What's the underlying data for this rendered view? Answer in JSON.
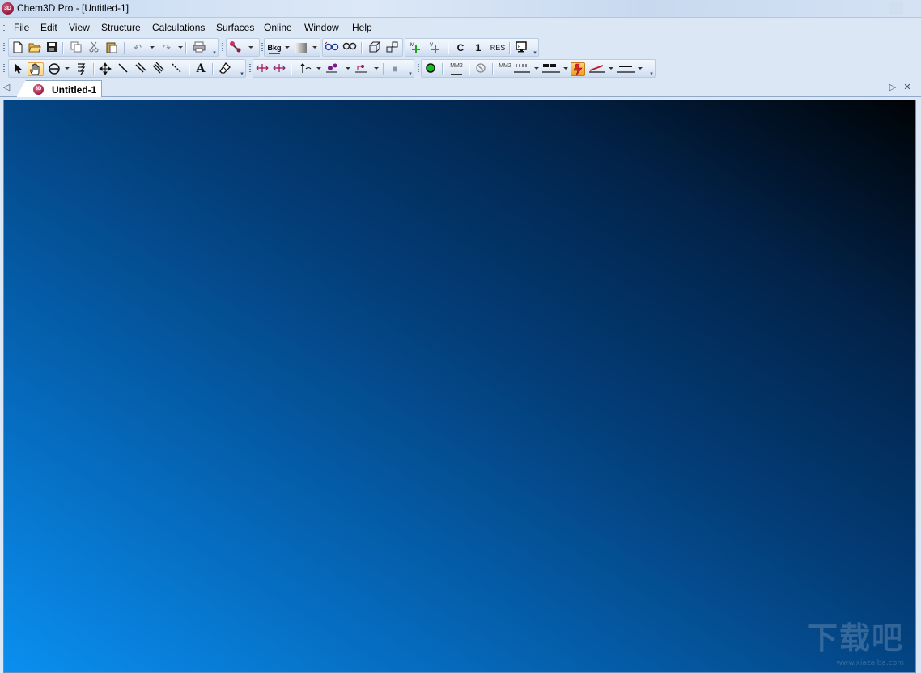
{
  "window": {
    "title": "Chem3D Pro - [Untitled-1]",
    "app_icon": "chem3d-app-icon",
    "app_icon_text": "3D"
  },
  "menu": {
    "items": [
      "File",
      "Edit",
      "View",
      "Structure",
      "Calculations",
      "Surfaces",
      "Online",
      "Window",
      "Help"
    ]
  },
  "toolbar1": {
    "new": "new-document-icon",
    "open": "open-folder-icon",
    "save": "save-icon",
    "copy": "copy-icon",
    "cut": "cut-icon",
    "paste": "paste-icon",
    "undo": "undo-icon",
    "redo": "redo-icon",
    "print": "print-icon",
    "bkg_label": "Bkg",
    "c_label": "C",
    "one_label": "1",
    "res_label": "RES",
    "mm2_label": "MM2"
  },
  "toolbar2": {
    "text_tool_label": "A",
    "mm2_a": "MM2",
    "mm2_b": "MM2"
  },
  "document_tab": {
    "label": "Untitled-1",
    "icon_text": "3D"
  },
  "watermark": {
    "glyphs": "下载吧",
    "url": "www.xiazaiba.com"
  },
  "colors": {
    "canvas_gradient_start": "#0a8ff0",
    "canvas_gradient_end": "#000306",
    "chrome": "#dce7f6"
  }
}
